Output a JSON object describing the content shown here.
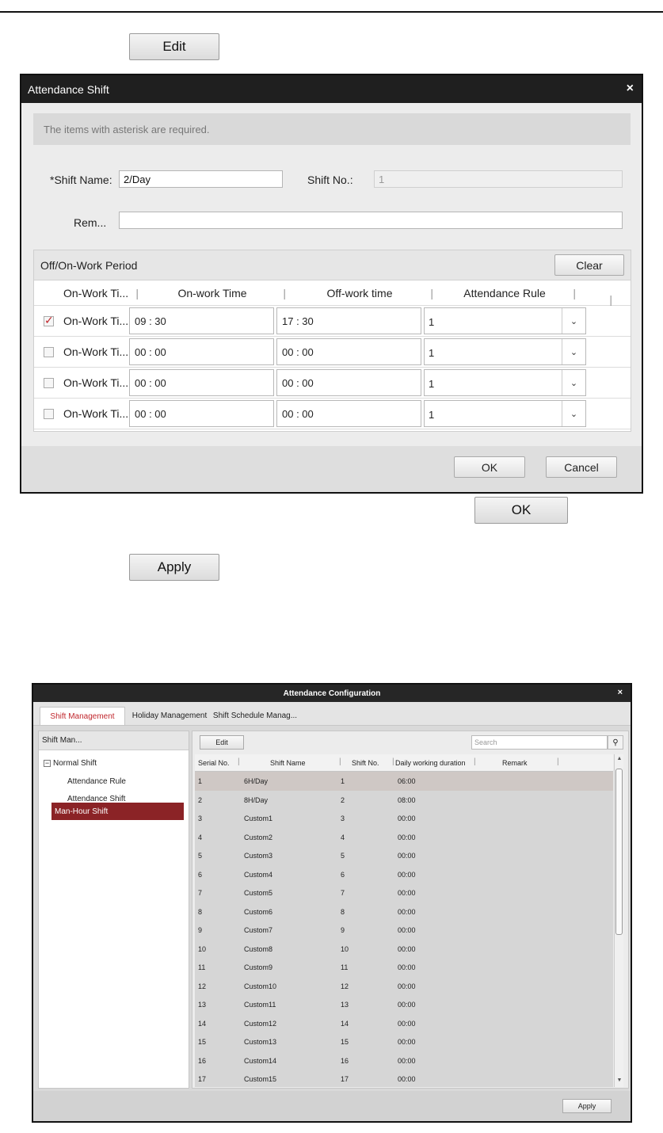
{
  "doc": {
    "edit_label": "Edit",
    "ok_label": "OK",
    "apply_label": "Apply"
  },
  "dialog": {
    "title": "Attendance Shift",
    "close_glyph": "×",
    "notice": "The items with asterisk are required.",
    "shift_name_label": "*Shift Name:",
    "shift_name_value": "2/Day",
    "shift_no_label": "Shift No.:",
    "shift_no_value": "1",
    "remark_label": "Rem...",
    "remark_value": "",
    "period_title": "Off/On-Work Period",
    "clear_label": "Clear",
    "columns": [
      "On-Work Ti...",
      "On-work Time",
      "Off-work time",
      "Attendance Rule"
    ],
    "rows": [
      {
        "checked": true,
        "name": "On-Work Ti...",
        "on": "09 : 30",
        "off": "17 : 30",
        "rule": "1"
      },
      {
        "checked": false,
        "name": "On-Work Ti...",
        "on": "00 : 00",
        "off": "00 : 00",
        "rule": "1"
      },
      {
        "checked": false,
        "name": "On-Work Ti...",
        "on": "00 : 00",
        "off": "00 : 00",
        "rule": "1"
      },
      {
        "checked": false,
        "name": "On-Work Ti...",
        "on": "00 : 00",
        "off": "00 : 00",
        "rule": "1"
      }
    ],
    "ok_label": "OK",
    "cancel_label": "Cancel",
    "dropdown_glyph": "⌄"
  },
  "config": {
    "title": "Attendance Configuration",
    "close_glyph": "×",
    "tabs": [
      "Shift Management",
      "Holiday Management",
      "Shift Schedule Manag..."
    ],
    "tree_header": "Shift Man...",
    "tree_root": "Normal Shift",
    "tree_toggle": "−",
    "tree_children": [
      "Attendance Rule",
      "Attendance Shift"
    ],
    "tree_selected": "Man-Hour Shift",
    "edit_label": "Edit",
    "search_placeholder": "Search",
    "search_glyph": "⚲",
    "columns": [
      "Serial No.",
      "Shift Name",
      "Shift No.",
      "Daily working duration",
      "Remark"
    ],
    "rows": [
      [
        "1",
        "6H/Day",
        "1",
        "06:00"
      ],
      [
        "2",
        "8H/Day",
        "2",
        "08:00"
      ],
      [
        "3",
        "Custom1",
        "3",
        "00:00"
      ],
      [
        "4",
        "Custom2",
        "4",
        "00:00"
      ],
      [
        "5",
        "Custom3",
        "5",
        "00:00"
      ],
      [
        "6",
        "Custom4",
        "6",
        "00:00"
      ],
      [
        "7",
        "Custom5",
        "7",
        "00:00"
      ],
      [
        "8",
        "Custom6",
        "8",
        "00:00"
      ],
      [
        "9",
        "Custom7",
        "9",
        "00:00"
      ],
      [
        "10",
        "Custom8",
        "10",
        "00:00"
      ],
      [
        "11",
        "Custom9",
        "11",
        "00:00"
      ],
      [
        "12",
        "Custom10",
        "12",
        "00:00"
      ],
      [
        "13",
        "Custom11",
        "13",
        "00:00"
      ],
      [
        "14",
        "Custom12",
        "14",
        "00:00"
      ],
      [
        "15",
        "Custom13",
        "15",
        "00:00"
      ],
      [
        "16",
        "Custom14",
        "16",
        "00:00"
      ],
      [
        "17",
        "Custom15",
        "17",
        "00:00"
      ]
    ],
    "scroll_up_glyph": "▲",
    "scroll_down_glyph": "▼",
    "apply_label": "Apply"
  }
}
